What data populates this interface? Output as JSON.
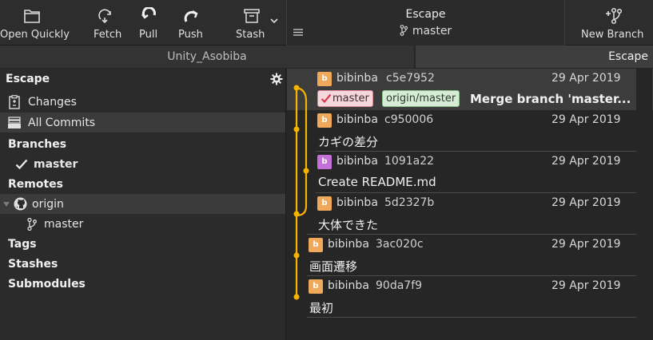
{
  "toolbar": {
    "buttons": [
      {
        "label": "Open Quickly",
        "icon": "folder-icon"
      },
      {
        "label": "Fetch",
        "icon": "fetch-icon"
      },
      {
        "label": "Pull",
        "icon": "pull-icon"
      },
      {
        "label": "Push",
        "icon": "push-icon"
      },
      {
        "label": "Stash",
        "icon": "stash-icon"
      },
      {
        "label": "New Branch",
        "icon": "new-branch-icon"
      }
    ],
    "repo_name": "Escape",
    "current_branch": "master"
  },
  "tabs": [
    "Unity_Asobiba",
    "Escape"
  ],
  "sidebar": {
    "title": "Escape",
    "items": {
      "changes": "Changes",
      "all_commits": "All Commits",
      "branches": "Branches",
      "branch_master": "master",
      "remotes": "Remotes",
      "remote_origin": "origin",
      "remote_master": "master",
      "tags": "Tags",
      "stashes": "Stashes",
      "submodules": "Submodules"
    }
  },
  "commits": [
    {
      "avatar": "b",
      "author": "bibinba",
      "hash": "c5e7952",
      "date": "29 Apr 2019",
      "message": "Merge branch 'master...",
      "tags": [
        "master",
        "origin/master"
      ]
    },
    {
      "avatar": "b",
      "author": "bibinba",
      "hash": "c950006",
      "date": "29 Apr 2019",
      "message": "カギの差分"
    },
    {
      "avatar": "b",
      "author": "bibinba",
      "hash": "1091a22",
      "date": "29 Apr 2019",
      "message": "Create README.md"
    },
    {
      "avatar": "b",
      "author": "bibinba",
      "hash": "5d2327b",
      "date": "29 Apr 2019",
      "message": "大体できた"
    },
    {
      "avatar": "b",
      "author": "bibinba",
      "hash": "3ac020c",
      "date": "29 Apr 2019",
      "message": "画面遷移"
    },
    {
      "avatar": "b",
      "author": "bibinba",
      "hash": "90da7f9",
      "date": "29 Apr 2019",
      "message": "最初"
    }
  ],
  "colors": {
    "graph_line": "#f5b400",
    "avatar_orange": "#f0a85a",
    "avatar_purple": "#c370d8",
    "local_tag": "#f6d7dc",
    "remote_tag": "#d6ecd5"
  }
}
